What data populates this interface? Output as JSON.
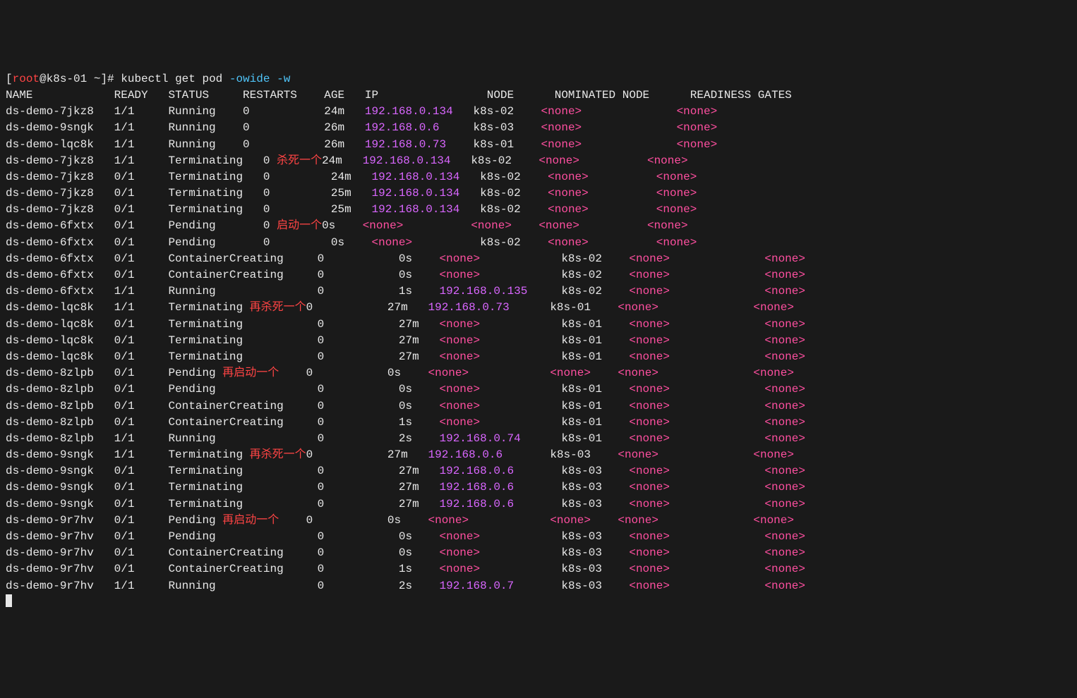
{
  "prompt": {
    "open": "[",
    "user": "root",
    "at": "@",
    "host": "k8s-01",
    "path": " ~",
    "close": "]# ",
    "cmd": "kubectl get pod ",
    "flags": "-owide -w"
  },
  "header": {
    "name": "NAME",
    "ready": "READY",
    "status": "STATUS",
    "restarts": "RESTARTS",
    "age": "AGE",
    "ip": "IP",
    "node": "NODE",
    "nominated": "NOMINATED NODE",
    "readiness": "READINESS GATES"
  },
  "rows": [
    {
      "layout": "A",
      "name": "ds-demo-7jkz8",
      "ready": "1/1",
      "status": "Running",
      "restarts": "0",
      "age": "24m",
      "ip": "192.168.0.134",
      "node": "k8s-02",
      "nom": "<none>",
      "rd": "<none>"
    },
    {
      "layout": "A",
      "name": "ds-demo-9sngk",
      "ready": "1/1",
      "status": "Running",
      "restarts": "0",
      "age": "26m",
      "ip": "192.168.0.6",
      "node": "k8s-03",
      "nom": "<none>",
      "rd": "<none>"
    },
    {
      "layout": "A",
      "name": "ds-demo-lqc8k",
      "ready": "1/1",
      "status": "Running",
      "restarts": "0",
      "age": "26m",
      "ip": "192.168.0.73",
      "node": "k8s-01",
      "nom": "<none>",
      "rd": "<none>"
    },
    {
      "layout": "B",
      "name": "ds-demo-7jkz8",
      "ready": "1/1",
      "status": "Terminating",
      "restarts": "0",
      "annotation": "杀死一个",
      "age": "24m",
      "ip": "192.168.0.134",
      "node": "k8s-02",
      "nom": "<none>",
      "rd": "<none>"
    },
    {
      "layout": "B",
      "name": "ds-demo-7jkz8",
      "ready": "0/1",
      "status": "Terminating",
      "restarts": "0",
      "age": "24m",
      "ip": "192.168.0.134",
      "node": "k8s-02",
      "nom": "<none>",
      "rd": "<none>"
    },
    {
      "layout": "B",
      "name": "ds-demo-7jkz8",
      "ready": "0/1",
      "status": "Terminating",
      "restarts": "0",
      "age": "25m",
      "ip": "192.168.0.134",
      "node": "k8s-02",
      "nom": "<none>",
      "rd": "<none>"
    },
    {
      "layout": "B",
      "name": "ds-demo-7jkz8",
      "ready": "0/1",
      "status": "Terminating",
      "restarts": "0",
      "age": "25m",
      "ip": "192.168.0.134",
      "node": "k8s-02",
      "nom": "<none>",
      "rd": "<none>"
    },
    {
      "layout": "B",
      "name": "ds-demo-6fxtx",
      "ready": "0/1",
      "status": "Pending",
      "restarts": "0",
      "annotation": "启动一个",
      "age": "0s",
      "ip": "<none>",
      "node": "<none>",
      "nom": "<none>",
      "rd": "<none>"
    },
    {
      "layout": "B",
      "name": "ds-demo-6fxtx",
      "ready": "0/1",
      "status": "Pending",
      "restarts": "0",
      "age": "0s",
      "ip": "<none>",
      "node": "k8s-02",
      "nom": "<none>",
      "rd": "<none>"
    },
    {
      "layout": "C",
      "name": "ds-demo-6fxtx",
      "ready": "0/1",
      "status": "ContainerCreating",
      "restarts": "0",
      "age": "0s",
      "ip": "<none>",
      "node": "k8s-02",
      "nom": "<none>",
      "rd": "<none>"
    },
    {
      "layout": "C",
      "name": "ds-demo-6fxtx",
      "ready": "0/1",
      "status": "ContainerCreating",
      "restarts": "0",
      "age": "0s",
      "ip": "<none>",
      "node": "k8s-02",
      "nom": "<none>",
      "rd": "<none>"
    },
    {
      "layout": "C",
      "name": "ds-demo-6fxtx",
      "ready": "1/1",
      "status": "Running",
      "restarts": "0",
      "age": "1s",
      "ip": "192.168.0.135",
      "node": "k8s-02",
      "nom": "<none>",
      "rd": "<none>"
    },
    {
      "layout": "C",
      "name": "ds-demo-lqc8k",
      "ready": "1/1",
      "status": "Terminating",
      "annotation": "再杀死一个",
      "restarts": "0",
      "age": "27m",
      "ip": "192.168.0.73",
      "node": "k8s-01",
      "nom": "<none>",
      "rd": "<none>"
    },
    {
      "layout": "C",
      "name": "ds-demo-lqc8k",
      "ready": "0/1",
      "status": "Terminating",
      "restarts": "0",
      "age": "27m",
      "ip": "<none>",
      "node": "k8s-01",
      "nom": "<none>",
      "rd": "<none>"
    },
    {
      "layout": "C",
      "name": "ds-demo-lqc8k",
      "ready": "0/1",
      "status": "Terminating",
      "restarts": "0",
      "age": "27m",
      "ip": "<none>",
      "node": "k8s-01",
      "nom": "<none>",
      "rd": "<none>"
    },
    {
      "layout": "C",
      "name": "ds-demo-lqc8k",
      "ready": "0/1",
      "status": "Terminating",
      "restarts": "0",
      "age": "27m",
      "ip": "<none>",
      "node": "k8s-01",
      "nom": "<none>",
      "rd": "<none>"
    },
    {
      "layout": "C",
      "name": "ds-demo-8zlpb",
      "ready": "0/1",
      "status": "Pending",
      "annotation": "再启动一个",
      "restarts": "0",
      "age": "0s",
      "ip": "<none>",
      "node": "<none>",
      "nom": "<none>",
      "rd": "<none>"
    },
    {
      "layout": "C",
      "name": "ds-demo-8zlpb",
      "ready": "0/1",
      "status": "Pending",
      "restarts": "0",
      "age": "0s",
      "ip": "<none>",
      "node": "k8s-01",
      "nom": "<none>",
      "rd": "<none>"
    },
    {
      "layout": "C",
      "name": "ds-demo-8zlpb",
      "ready": "0/1",
      "status": "ContainerCreating",
      "restarts": "0",
      "age": "0s",
      "ip": "<none>",
      "node": "k8s-01",
      "nom": "<none>",
      "rd": "<none>"
    },
    {
      "layout": "C",
      "name": "ds-demo-8zlpb",
      "ready": "0/1",
      "status": "ContainerCreating",
      "restarts": "0",
      "age": "1s",
      "ip": "<none>",
      "node": "k8s-01",
      "nom": "<none>",
      "rd": "<none>"
    },
    {
      "layout": "C",
      "name": "ds-demo-8zlpb",
      "ready": "1/1",
      "status": "Running",
      "restarts": "0",
      "age": "2s",
      "ip": "192.168.0.74",
      "node": "k8s-01",
      "nom": "<none>",
      "rd": "<none>"
    },
    {
      "layout": "C",
      "name": "ds-demo-9sngk",
      "ready": "1/1",
      "status": "Terminating",
      "annotation": "再杀死一个",
      "restarts": "0",
      "age": "27m",
      "ip": "192.168.0.6",
      "node": "k8s-03",
      "nom": "<none>",
      "rd": "<none>"
    },
    {
      "layout": "C",
      "name": "ds-demo-9sngk",
      "ready": "0/1",
      "status": "Terminating",
      "restarts": "0",
      "age": "27m",
      "ip": "192.168.0.6",
      "node": "k8s-03",
      "nom": "<none>",
      "rd": "<none>"
    },
    {
      "layout": "C",
      "name": "ds-demo-9sngk",
      "ready": "0/1",
      "status": "Terminating",
      "restarts": "0",
      "age": "27m",
      "ip": "192.168.0.6",
      "node": "k8s-03",
      "nom": "<none>",
      "rd": "<none>"
    },
    {
      "layout": "C",
      "name": "ds-demo-9sngk",
      "ready": "0/1",
      "status": "Terminating",
      "restarts": "0",
      "age": "27m",
      "ip": "192.168.0.6",
      "node": "k8s-03",
      "nom": "<none>",
      "rd": "<none>"
    },
    {
      "layout": "C",
      "name": "ds-demo-9r7hv",
      "ready": "0/1",
      "status": "Pending",
      "annotation": "再启动一个",
      "restarts": "0",
      "age": "0s",
      "ip": "<none>",
      "node": "<none>",
      "nom": "<none>",
      "rd": "<none>"
    },
    {
      "layout": "C",
      "name": "ds-demo-9r7hv",
      "ready": "0/1",
      "status": "Pending",
      "restarts": "0",
      "age": "0s",
      "ip": "<none>",
      "node": "k8s-03",
      "nom": "<none>",
      "rd": "<none>"
    },
    {
      "layout": "C",
      "name": "ds-demo-9r7hv",
      "ready": "0/1",
      "status": "ContainerCreating",
      "restarts": "0",
      "age": "0s",
      "ip": "<none>",
      "node": "k8s-03",
      "nom": "<none>",
      "rd": "<none>"
    },
    {
      "layout": "C",
      "name": "ds-demo-9r7hv",
      "ready": "0/1",
      "status": "ContainerCreating",
      "restarts": "0",
      "age": "1s",
      "ip": "<none>",
      "node": "k8s-03",
      "nom": "<none>",
      "rd": "<none>"
    },
    {
      "layout": "C",
      "name": "ds-demo-9r7hv",
      "ready": "1/1",
      "status": "Running",
      "restarts": "0",
      "age": "2s",
      "ip": "192.168.0.7",
      "node": "k8s-03",
      "nom": "<none>",
      "rd": "<none>"
    }
  ]
}
